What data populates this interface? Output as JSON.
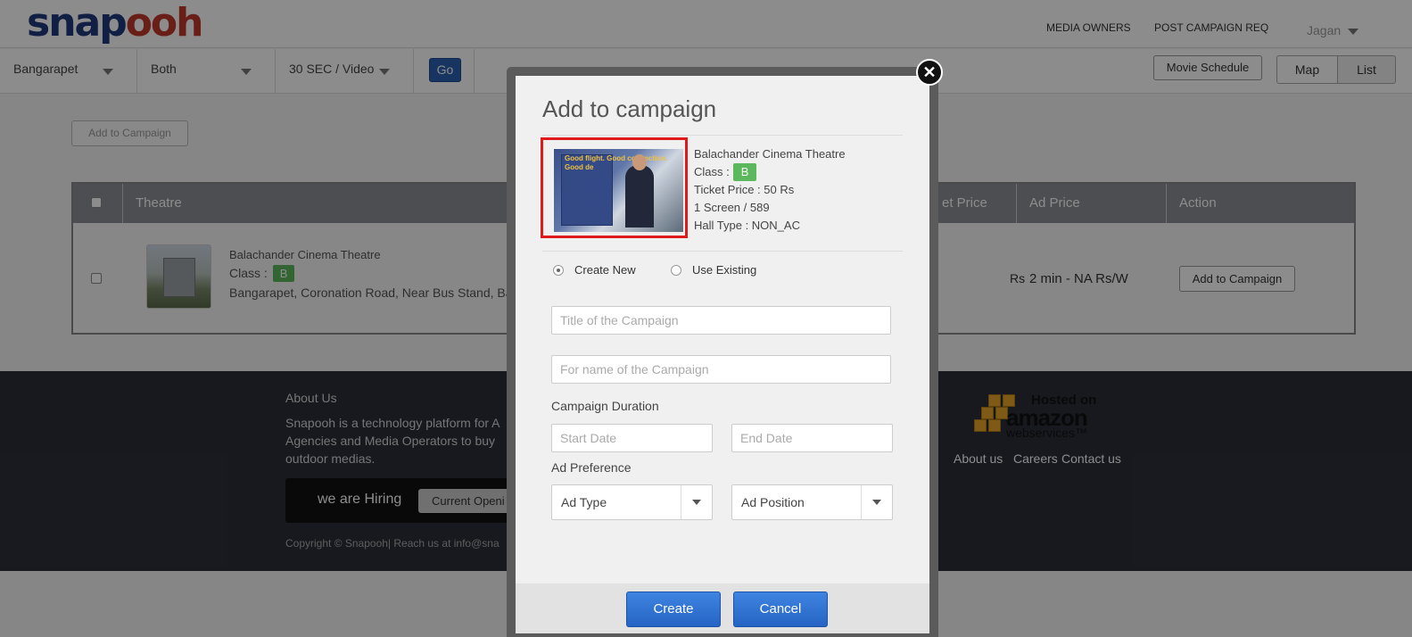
{
  "header": {
    "logo_part1": "snap",
    "logo_part2": "ooh",
    "nav_media_owners": "MEDIA OWNERS",
    "nav_post_campaign": "POST CAMPAIGN REQ",
    "user": "Jagan"
  },
  "filters": {
    "location": "Bangarapet",
    "type": "Both",
    "duration": "30 SEC / Video",
    "go_label": "Go",
    "movie_schedule_label": "Movie Schedule",
    "map_label": "Map",
    "list_label": "List"
  },
  "main": {
    "add_to_campaign_top": "Add to Campaign",
    "table": {
      "col_theatre": "Theatre",
      "col_ticket_price": "et Price",
      "col_ad_price": "Ad Price",
      "col_action": "Action",
      "row": {
        "name": "Balachander Cinema Theatre",
        "class_label": "Class :",
        "class_value": "B",
        "address": "Bangarapet, Coronation Road, Near Bus Stand, Ba",
        "ticket_price": "Rs",
        "ad_price": "2 min - NA Rs/W",
        "action_label": "Add to Campaign"
      }
    }
  },
  "footer": {
    "about_title": "About Us",
    "about_line1": "Snapooh is a technology platform for A",
    "about_line2": "Agencies and Media Operators to buy",
    "about_line3": "outdoor medias.",
    "hiring_label": "we are Hiring",
    "hiring_button": "Current Openi",
    "copyright": "Copyright © Snapooh| Reach us at info@sna",
    "aws_hosted": "Hosted on",
    "aws_amazon": "amazon",
    "aws_webservices": "webservices™",
    "link_about": "About us",
    "link_careers": "Careers",
    "link_contact": "Contact us"
  },
  "modal": {
    "title": "Add to campaign",
    "theatre_name": "Balachander Cinema Theatre",
    "class_label": "Class :",
    "class_value": "B",
    "ticket_price": "Ticket Price : 50 Rs",
    "screens": "1 Screen / 589",
    "hall_type": "Hall Type : NON_AC",
    "image_text": "Good flight. Good connection. Good de",
    "radio_create_new": "Create New",
    "radio_use_existing": "Use Existing",
    "title_placeholder": "Title of the Campaign",
    "for_name_placeholder": "For name of the Campaign",
    "duration_label": "Campaign Duration",
    "start_date_placeholder": "Start Date",
    "end_date_placeholder": "End Date",
    "ad_preference_label": "Ad Preference",
    "ad_type": "Ad Type",
    "ad_position": "Ad Position",
    "create_label": "Create",
    "cancel_label": "Cancel",
    "close_icon": "close-icon"
  },
  "colors": {
    "brand_blue": "#1e3a7a",
    "brand_red": "#c0392b",
    "button_blue": "#2664c4",
    "class_green": "#5cb85c",
    "highlight_red": "#e0191b"
  }
}
